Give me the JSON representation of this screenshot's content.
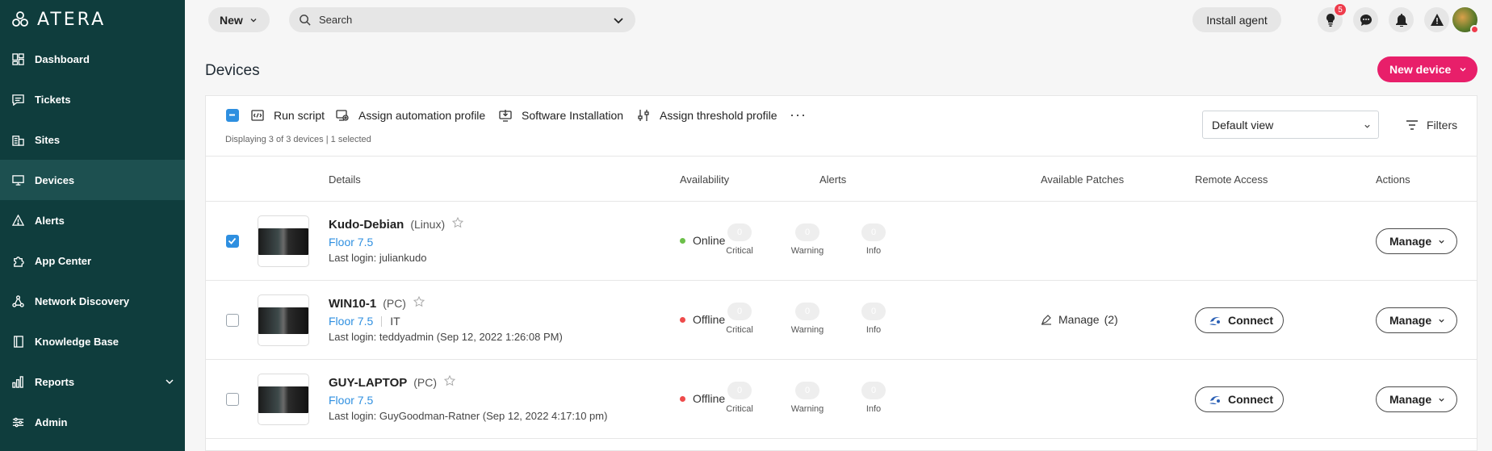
{
  "brand": {
    "name": "ATERA"
  },
  "sidebar": {
    "items": [
      {
        "label": "Dashboard",
        "icon": "dashboard-icon"
      },
      {
        "label": "Tickets",
        "icon": "tickets-icon"
      },
      {
        "label": "Sites",
        "icon": "sites-icon"
      },
      {
        "label": "Devices",
        "icon": "devices-icon",
        "active": true
      },
      {
        "label": "Alerts",
        "icon": "alerts-icon"
      },
      {
        "label": "App Center",
        "icon": "app-center-icon"
      },
      {
        "label": "Network Discovery",
        "icon": "network-discovery-icon"
      },
      {
        "label": "Knowledge Base",
        "icon": "knowledge-base-icon"
      },
      {
        "label": "Reports",
        "icon": "reports-icon",
        "expandable": true
      },
      {
        "label": "Admin",
        "icon": "admin-icon"
      }
    ]
  },
  "topbar": {
    "new_label": "New",
    "search_label": "Search",
    "install_label": "Install agent",
    "notification_badge": "5"
  },
  "page": {
    "title": "Devices",
    "new_device_label": "New device"
  },
  "toolbar": {
    "actions": [
      {
        "label": "Run script",
        "icon": "script-icon"
      },
      {
        "label": "Assign automation profile",
        "icon": "automation-icon"
      },
      {
        "label": "Software Installation",
        "icon": "software-install-icon"
      },
      {
        "label": "Assign threshold profile",
        "icon": "threshold-icon"
      }
    ],
    "more_label": "···",
    "display_info": "Displaying 3 of 3 devices | 1 selected",
    "view_select": "Default view",
    "filters_label": "Filters"
  },
  "table": {
    "headers": {
      "details": "Details",
      "availability": "Availability",
      "alerts": "Alerts",
      "patches": "Available Patches",
      "remote": "Remote Access",
      "actions": "Actions"
    },
    "rows": [
      {
        "checked": true,
        "name": "Kudo-Debian",
        "type": "(Linux)",
        "floor": "Floor 7.5",
        "group": "",
        "login": "Last login: juliankudo",
        "availability": "Online",
        "availability_color": "#6cc04a",
        "alerts": [
          {
            "count": "0",
            "label": "Critical"
          },
          {
            "count": "0",
            "label": "Warning"
          },
          {
            "count": "0",
            "label": "Info"
          }
        ],
        "patches_label": "",
        "patches_count": "",
        "connect_label": "",
        "manage_label": "Manage"
      },
      {
        "checked": false,
        "name": "WIN10-1",
        "type": "(PC)",
        "floor": "Floor 7.5",
        "group": "IT",
        "login": "Last login: teddyadmin (Sep 12, 2022 1:26:08 PM)",
        "availability": "Offline",
        "availability_color": "#ee4b4b",
        "alerts": [
          {
            "count": "0",
            "label": "Critical"
          },
          {
            "count": "0",
            "label": "Warning"
          },
          {
            "count": "0",
            "label": "Info"
          }
        ],
        "patches_label": "Manage",
        "patches_count": "(2)",
        "connect_label": "Connect",
        "manage_label": "Manage"
      },
      {
        "checked": false,
        "name": "GUY-LAPTOP",
        "type": "(PC)",
        "floor": "Floor 7.5",
        "group": "",
        "login": "Last login: GuyGoodman-Ratner (Sep 12, 2022 4:17:10 pm)",
        "availability": "Offline",
        "availability_color": "#ee4b4b",
        "alerts": [
          {
            "count": "0",
            "label": "Critical"
          },
          {
            "count": "0",
            "label": "Warning"
          },
          {
            "count": "0",
            "label": "Info"
          }
        ],
        "patches_label": "",
        "patches_count": "",
        "connect_label": "Connect",
        "manage_label": "Manage"
      }
    ]
  }
}
